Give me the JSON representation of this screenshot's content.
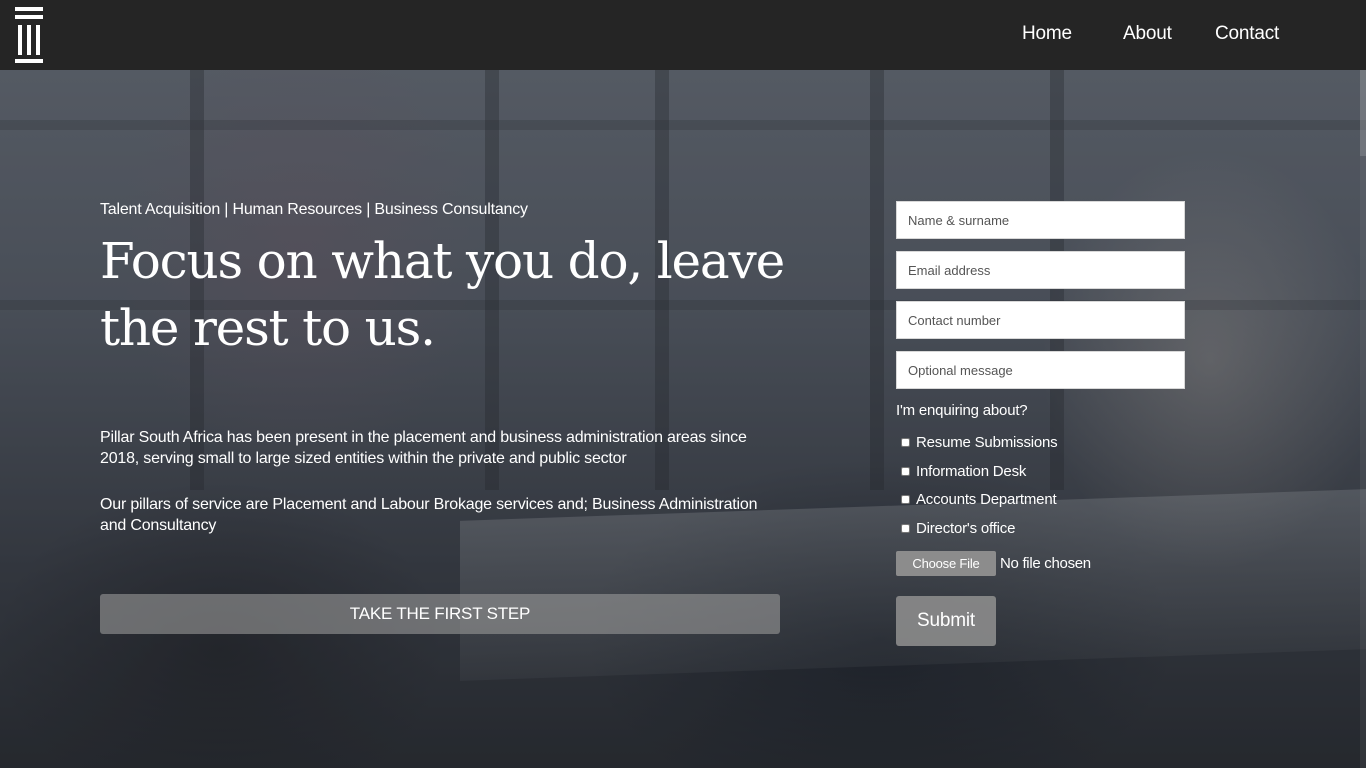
{
  "nav": {
    "home": "Home",
    "about": "About",
    "contact": "Contact"
  },
  "hero": {
    "kicker": "Talent Acquisition | Human Resources | Business Consultancy",
    "headline_line1": "Focus on what you do, leave",
    "headline_line2": "the rest to us.",
    "paragraph1": "Pillar South Africa has been present in the placement and business administration areas since 2018, serving small to large sized entities within the private and public sector",
    "paragraph2": "Our pillars of service are Placement and Labour Brokage services and; Business Administration and Consultancy",
    "cta_label": "TAKE THE FIRST STEP"
  },
  "form": {
    "name_placeholder": "Name & surname",
    "email_placeholder": "Email address",
    "phone_placeholder": "Contact number",
    "message_placeholder": "Optional message",
    "enquire_label": "I'm enquiring about?",
    "options": [
      {
        "label": "Resume Submissions",
        "checked": false
      },
      {
        "label": "Information Desk",
        "checked": false
      },
      {
        "label": "Accounts Department",
        "checked": false
      },
      {
        "label": "Director's office",
        "checked": false
      }
    ],
    "file_button": "Choose File",
    "file_status": "No file chosen",
    "submit_label": "Submit"
  },
  "icons": {
    "logo": "pillar-logo-icon"
  },
  "colors": {
    "header_bg": "#252525",
    "text": "#ffffff",
    "cta_bg": "#969696"
  }
}
